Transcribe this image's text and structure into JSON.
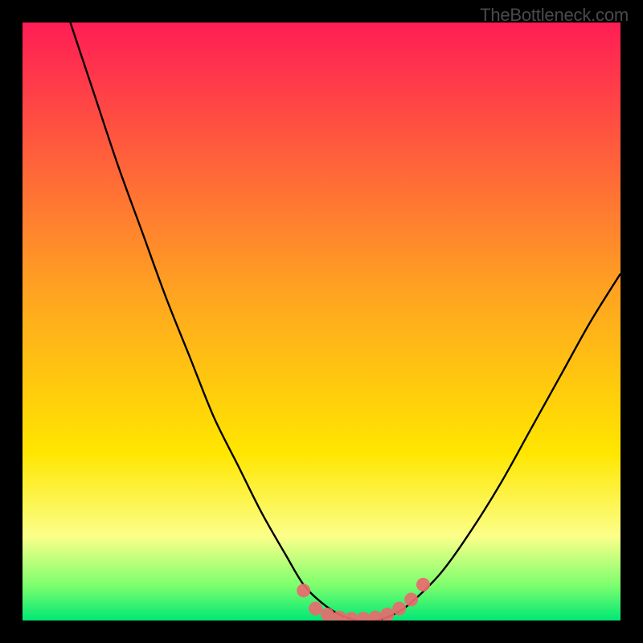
{
  "watermark": "TheBottleneck.com",
  "chart_data": {
    "type": "line",
    "title": "",
    "xlabel": "",
    "ylabel": "",
    "xlim": [
      0,
      100
    ],
    "ylim": [
      0,
      100
    ],
    "series": [
      {
        "name": "bottleneck-curve",
        "x": [
          8,
          12,
          16,
          20,
          24,
          28,
          32,
          36,
          40,
          44,
          47,
          50,
          53,
          56,
          59,
          62,
          65,
          70,
          75,
          80,
          85,
          90,
          95,
          100
        ],
        "y": [
          100,
          88,
          76,
          65,
          54,
          44,
          34,
          26,
          18,
          11,
          6,
          3,
          1,
          0,
          0,
          1,
          3,
          8,
          15,
          23,
          32,
          41,
          50,
          58
        ]
      }
    ],
    "markers": {
      "name": "highlight-dots",
      "x": [
        47,
        49,
        51,
        53,
        55,
        57,
        59,
        61,
        63,
        65,
        67
      ],
      "y": [
        5,
        2,
        1,
        0.5,
        0.3,
        0.3,
        0.5,
        1,
        2,
        3.5,
        6
      ]
    },
    "gradient_stops": [
      {
        "offset": 0,
        "color": "#ff1d55"
      },
      {
        "offset": 45,
        "color": "#ffa321"
      },
      {
        "offset": 72,
        "color": "#ffe600"
      },
      {
        "offset": 86,
        "color": "#fbff8a"
      },
      {
        "offset": 94,
        "color": "#7fff6e"
      },
      {
        "offset": 100,
        "color": "#00e874"
      }
    ]
  }
}
